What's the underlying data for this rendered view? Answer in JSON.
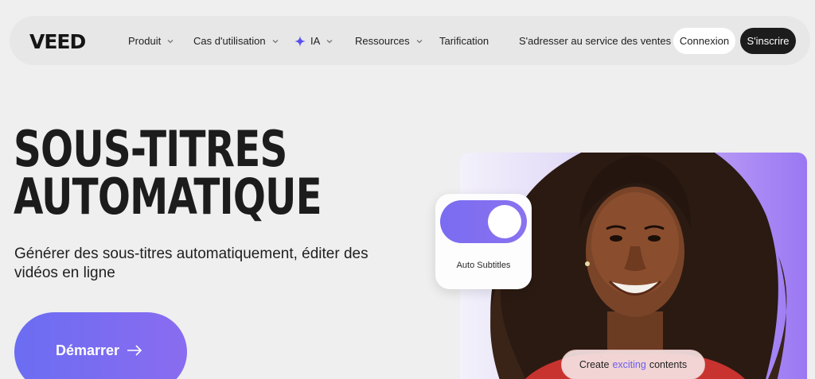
{
  "brand": {
    "logo": "VEED"
  },
  "nav": {
    "items": [
      {
        "label": "Produit",
        "dropdown": true
      },
      {
        "label": "Cas d'utilisation",
        "dropdown": true
      },
      {
        "label": "IA",
        "dropdown": true,
        "icon": "sparkle-icon"
      },
      {
        "label": "Ressources",
        "dropdown": true
      },
      {
        "label": "Tarification",
        "dropdown": false
      },
      {
        "label": "S'adresser au service des ventes",
        "dropdown": false
      }
    ],
    "login_label": "Connexion",
    "signup_label": "S'inscrire"
  },
  "hero": {
    "title_line1": "SOUS-TITRES",
    "title_line2": "AUTOMATIQUE",
    "subtitle": "Générer des sous-titres automatiquement, éditer des vidéos en ligne",
    "cta_label": "Démarrer",
    "cta_icon": "arrow-right-icon"
  },
  "visual": {
    "toggle_label": "Auto Subtitles",
    "toggle_state": "on",
    "pill_pre": "Create",
    "pill_highlight": "exciting",
    "pill_post": "contents"
  },
  "colors": {
    "background": "#eeefee",
    "accent": "#6b6df2",
    "dark": "#1c1c1c",
    "highlight": "#6a5ef0"
  }
}
